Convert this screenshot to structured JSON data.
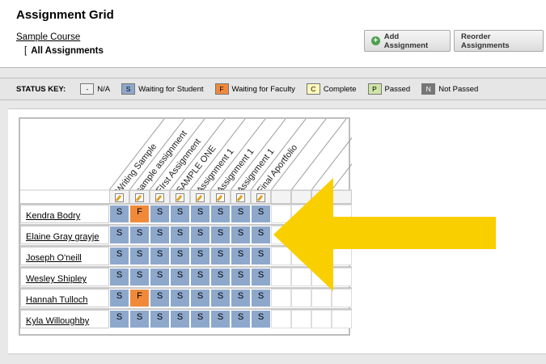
{
  "header": {
    "title": "Assignment Grid",
    "course_link": "Sample Course",
    "breadcrumb_bracket": "[",
    "breadcrumb_current": "All Assignments",
    "add_button": "Add Assignment",
    "reorder_button": "Reorder Assignments"
  },
  "status_key": {
    "title": "STATUS KEY:",
    "items": [
      {
        "code": "-",
        "label": "N/A",
        "color": "#f0f0f0"
      },
      {
        "code": "S",
        "label": "Waiting for Student",
        "color": "#8ea8cc"
      },
      {
        "code": "F",
        "label": "Waiting for Faculty",
        "color": "#f08a3a"
      },
      {
        "code": "C",
        "label": "Complete",
        "color": "#fff9b8"
      },
      {
        "code": "P",
        "label": "Passed",
        "color": "#cfe5a8"
      },
      {
        "code": "N",
        "label": "Not Passed",
        "color": "#777777"
      }
    ]
  },
  "grid": {
    "columns": [
      "Writing Sample",
      "sample assignment",
      "FIrst Assignment",
      "SAMPLE ONE",
      "Assignment 1",
      "Assignment 1",
      "Assignment 1",
      "Final Aportfolio"
    ],
    "rows": [
      {
        "name": "Kendra Bodry",
        "cells": [
          "S",
          "F",
          "S",
          "S",
          "S",
          "S",
          "S",
          "S"
        ]
      },
      {
        "name": "Elaine Gray grayje",
        "cells": [
          "S",
          "S",
          "S",
          "S",
          "S",
          "S",
          "S",
          "S"
        ]
      },
      {
        "name": "Joseph O'neill",
        "cells": [
          "S",
          "S",
          "S",
          "S",
          "S",
          "S",
          "S",
          "S"
        ]
      },
      {
        "name": "Wesley Shipley",
        "cells": [
          "S",
          "S",
          "S",
          "S",
          "S",
          "S",
          "S",
          "S"
        ]
      },
      {
        "name": "Hannah Tulloch",
        "cells": [
          "S",
          "F",
          "S",
          "S",
          "S",
          "S",
          "S",
          "S"
        ]
      },
      {
        "name": "Kyla Willoughby",
        "cells": [
          "S",
          "S",
          "S",
          "S",
          "S",
          "S",
          "S",
          "S"
        ]
      }
    ]
  },
  "annotation": {
    "arrow_color": "#f9cf00"
  }
}
